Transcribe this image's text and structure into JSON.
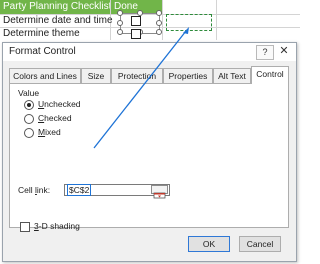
{
  "sheet": {
    "header_col_a": "Party Planning Checklist",
    "header_col_b": "Done",
    "rows": [
      "Determine date and time",
      "Determine theme"
    ]
  },
  "dialog": {
    "title": "Format Control",
    "help": "?",
    "close": "✕",
    "tabs": [
      "Colors and Lines",
      "Size",
      "Protection",
      "Properties",
      "Alt Text",
      "Control"
    ],
    "active_tab": "Control",
    "value_group_label": "Value",
    "options": {
      "unchecked": {
        "access_key": "U",
        "rest": "nchecked"
      },
      "checked": {
        "access_key": "C",
        "rest": "hecked"
      },
      "mixed": {
        "access_key": "M",
        "rest": "ixed"
      }
    },
    "cell_link": {
      "prefix": "Cell ",
      "access_key": "l",
      "suffix": "ink:",
      "value": "$C$2"
    },
    "shading": {
      "access_key": "3",
      "rest": "-D shading"
    },
    "ok": "OK",
    "cancel": "Cancel"
  },
  "colors": {
    "header_green": "#71b549",
    "link_blue": "#1e73d6",
    "dash_green": "#2e8b3b"
  },
  "icons": {
    "collapse_dialog": "collapse-dialog-icon",
    "arrow": "link-arrow"
  }
}
